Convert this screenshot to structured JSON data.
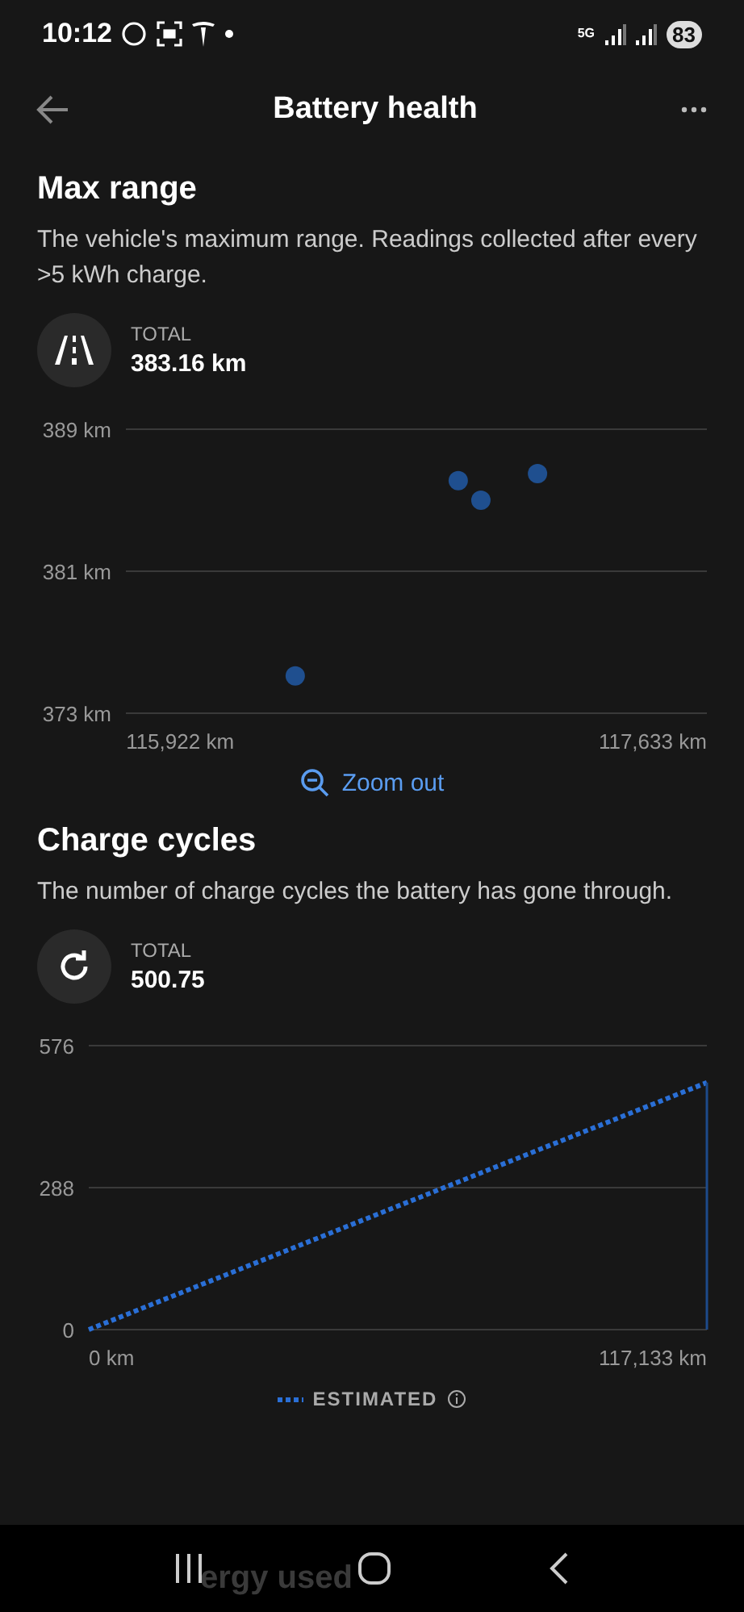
{
  "status_bar": {
    "time": "10:12",
    "network": "5G",
    "battery": "83"
  },
  "header": {
    "title": "Battery health"
  },
  "sections": [
    {
      "title": "Max range",
      "description": "The vehicle's maximum range. Readings collected after every >5 kWh charge.",
      "kind": "range",
      "total_label": "TOTAL",
      "total_value": "383.16 km",
      "chart_data": {
        "type": "scatter",
        "x": [
          116339,
          116929,
          117011,
          117216
        ],
        "series": [
          {
            "color": "#1f4f8f",
            "values": [
              375.1,
              386.1,
              385.0,
              386.5
            ]
          }
        ],
        "xlim": [
          115726,
          117829
        ],
        "ylim": [
          373,
          389
        ],
        "xticks": [
          {
            "value": 115922,
            "label": "115,922 km"
          },
          {
            "value": 117633,
            "label": "117,633 km"
          }
        ],
        "yticks": [
          {
            "value": 373,
            "label": "373 km"
          },
          {
            "value": 381,
            "label": "381 km"
          },
          {
            "value": 389,
            "label": "389 km"
          }
        ]
      },
      "action": "Zoom out"
    },
    {
      "title": "Charge cycles",
      "description": "The number of charge cycles the battery has gone through.",
      "kind": "cycles",
      "total_label": "TOTAL",
      "total_value": "500.75",
      "chart_data": {
        "type": "line",
        "x": [
          -4919,
          128826
        ],
        "series": [
          {
            "name": "ESTIMATED",
            "color": "#2a6fd6",
            "line_style": "dashed",
            "values": [
              0,
              501
            ]
          }
        ],
        "xlim": [
          -4919,
          128826
        ],
        "ylim": [
          0,
          576
        ],
        "xticks": [
          {
            "value": 0,
            "label": "0 km"
          },
          {
            "value": 117133,
            "label": "117,133 km"
          }
        ],
        "yticks": [
          0,
          288,
          576
        ]
      }
    }
  ],
  "next_section": {
    "title": "ergy used"
  }
}
